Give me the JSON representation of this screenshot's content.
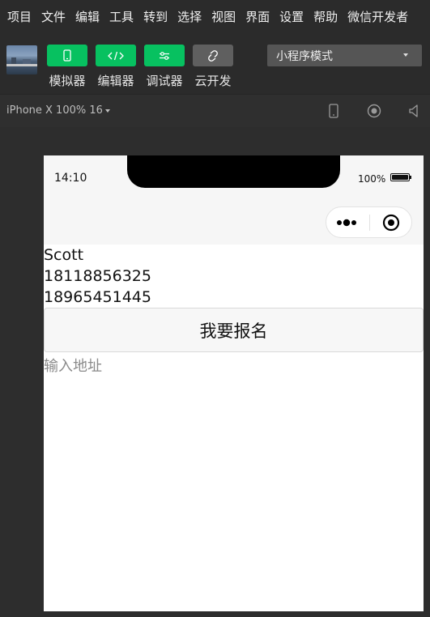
{
  "menu": [
    "项目",
    "文件",
    "编辑",
    "工具",
    "转到",
    "选择",
    "视图",
    "界面",
    "设置",
    "帮助",
    "微信开发者"
  ],
  "toolbar": {
    "buttons": [
      {
        "label": "模拟器",
        "icon": "phone-icon",
        "color": "#07c160"
      },
      {
        "label": "编辑器",
        "icon": "code-icon",
        "color": "#07c160"
      },
      {
        "label": "调试器",
        "icon": "debug-icon",
        "color": "#07c160"
      },
      {
        "label": "云开发",
        "icon": "cloud-link-icon",
        "color": "#5f5f5f"
      }
    ],
    "mode_select": "小程序模式"
  },
  "device": {
    "label": "iPhone X 100% 16",
    "icons": [
      "phone-outline-icon",
      "record-icon",
      "volume-icon"
    ]
  },
  "simulator": {
    "time": "14:10",
    "battery": "100%",
    "lines": [
      "Scott",
      "18118856325",
      "18965451445"
    ],
    "signup_button": "我要报名",
    "address_placeholder": "输入地址"
  }
}
